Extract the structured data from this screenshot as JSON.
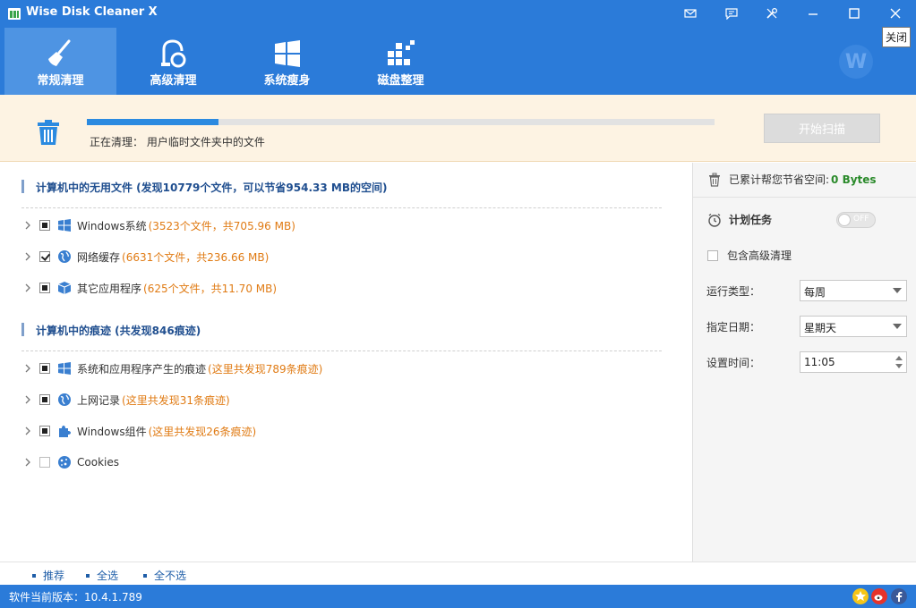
{
  "app": {
    "title": "Wise Disk Cleaner X",
    "tooltip": "关闭"
  },
  "nav": {
    "tabs": [
      {
        "label": "常规清理",
        "icon": "broom-icon"
      },
      {
        "label": "高级清理",
        "icon": "vacuum-icon"
      },
      {
        "label": "系统瘦身",
        "icon": "windows-icon"
      },
      {
        "label": "磁盘整理",
        "icon": "defrag-blocks-icon"
      }
    ],
    "avatar_letter": "W"
  },
  "scan": {
    "status_prefix": "正在清理：",
    "status_text": "用户临时文件夹中的文件",
    "progress_percent": 21,
    "start_button": "开始扫描"
  },
  "sections": [
    {
      "title": "计算机中的无用文件 (发现10779个文件，可以节省954.33 MB的空间)",
      "items": [
        {
          "name": "Windows系统",
          "desc": "(3523个文件，共705.96 MB)",
          "check": "partial",
          "icon": "windows-logo-icon"
        },
        {
          "name": "网络缓存",
          "desc": "(6631个文件，共236.66 MB)",
          "check": "checked",
          "icon": "globe-icon"
        },
        {
          "name": "其它应用程序",
          "desc": "(625个文件，共11.70 MB)",
          "check": "partial",
          "icon": "box-icon"
        }
      ]
    },
    {
      "title": "计算机中的痕迹 (共发现846痕迹)",
      "items": [
        {
          "name": "系统和应用程序产生的痕迹",
          "desc": "(这里共发现789条痕迹)",
          "check": "partial",
          "icon": "windows-logo-icon"
        },
        {
          "name": "上网记录",
          "desc": "(这里共发现31条痕迹)",
          "check": "partial",
          "icon": "globe-icon"
        },
        {
          "name": "Windows组件",
          "desc": "(这里共发现26条痕迹)",
          "check": "partial",
          "icon": "puzzle-icon"
        },
        {
          "name": "Cookies",
          "desc": "",
          "check": "empty",
          "icon": "cookie-icon"
        }
      ]
    }
  ],
  "right_panel": {
    "saved_label": "已累计帮您节省空间:",
    "saved_value": "0 Bytes",
    "schedule_label": "计划任务",
    "toggle_text": "OFF",
    "include_advanced": "包含高级清理",
    "run_type_label": "运行类型：",
    "run_type_value": "每周",
    "day_label": "指定日期：",
    "day_value": "星期天",
    "time_label": "设置时间：",
    "time_value": "11:05"
  },
  "footer": {
    "links": [
      "推荐",
      "全选",
      "全不选"
    ],
    "version": "软件当前版本：10.4.1.789"
  },
  "colors": {
    "primary": "#2b7bd9",
    "accent_orange": "#e07b14",
    "saved_green": "#2a8a2a"
  }
}
